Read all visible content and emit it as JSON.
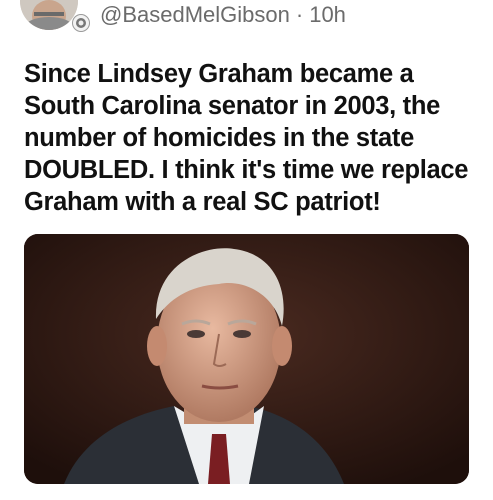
{
  "author": {
    "handle": "@BasedMelGibson",
    "separator": "·",
    "time_ago": "10h",
    "avatar_icon": "profile-photo-avatar",
    "badge_icon": "seal-badge-icon"
  },
  "tweet": {
    "text": "Since Lindsey Graham became a South Carolina senator in 2003, the number of homicides in the state DOUBLED. I think it's time we replace Graham with a real SC patriot!"
  },
  "media": {
    "kind": "photo",
    "subject": "portrait-photo"
  },
  "colors": {
    "text": "#111111",
    "muted": "#6b6b6b",
    "background": "#ffffff"
  }
}
